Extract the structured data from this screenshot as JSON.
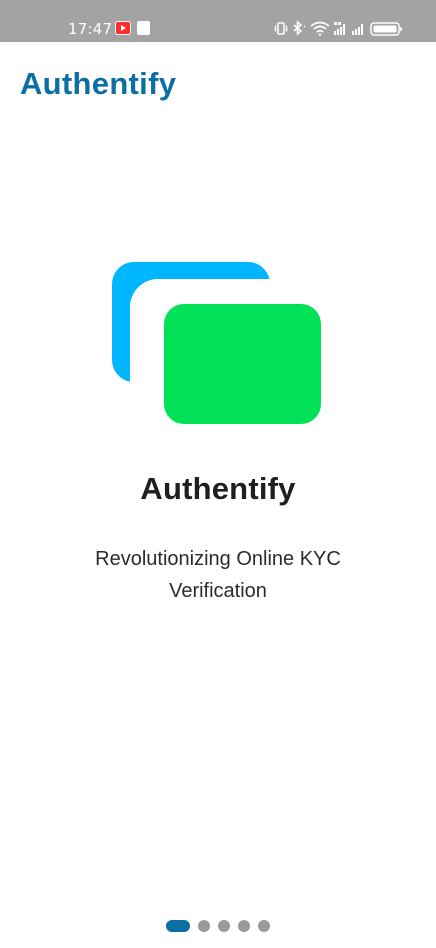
{
  "status_bar": {
    "time": "17:47",
    "icons": [
      "youtube-notification-icon",
      "notification-icon",
      "vibrate-icon",
      "bluetooth-icon",
      "wifi-icon",
      "signal-icon",
      "signal-icon",
      "battery-icon"
    ]
  },
  "app_bar": {
    "title": "Authentify"
  },
  "onboarding": {
    "logo_icon": "cards-logo-icon",
    "title": "Authentify",
    "subtitle": "Revolutionizing Online KYC Verification",
    "page_count": 5,
    "current_page": 1
  },
  "colors": {
    "brand": "#0b6fa3",
    "card_back": "#00b7ff",
    "card_front": "#00e157",
    "status_bar": "#a3a3a3",
    "dot_inactive": "#9a9a9a"
  }
}
